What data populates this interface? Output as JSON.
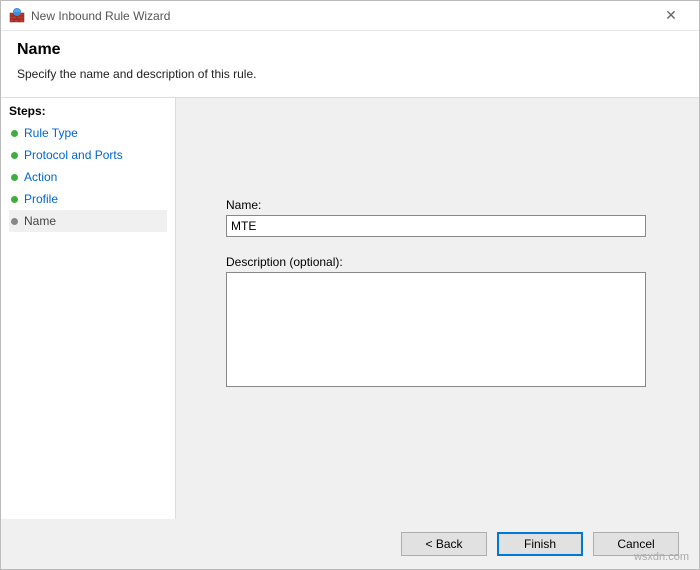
{
  "window": {
    "title": "New Inbound Rule Wizard"
  },
  "header": {
    "title": "Name",
    "subtitle": "Specify the name and description of this rule."
  },
  "sidebar": {
    "label": "Steps:",
    "items": [
      {
        "label": "Rule Type",
        "state": "done"
      },
      {
        "label": "Protocol and Ports",
        "state": "done"
      },
      {
        "label": "Action",
        "state": "done"
      },
      {
        "label": "Profile",
        "state": "done"
      },
      {
        "label": "Name",
        "state": "current"
      }
    ]
  },
  "form": {
    "name": {
      "label": "Name:",
      "value": "MTE"
    },
    "description": {
      "label": "Description (optional):",
      "value": ""
    }
  },
  "buttons": {
    "back": "< Back",
    "finish": "Finish",
    "cancel": "Cancel"
  },
  "watermark": "wsxdn.com"
}
